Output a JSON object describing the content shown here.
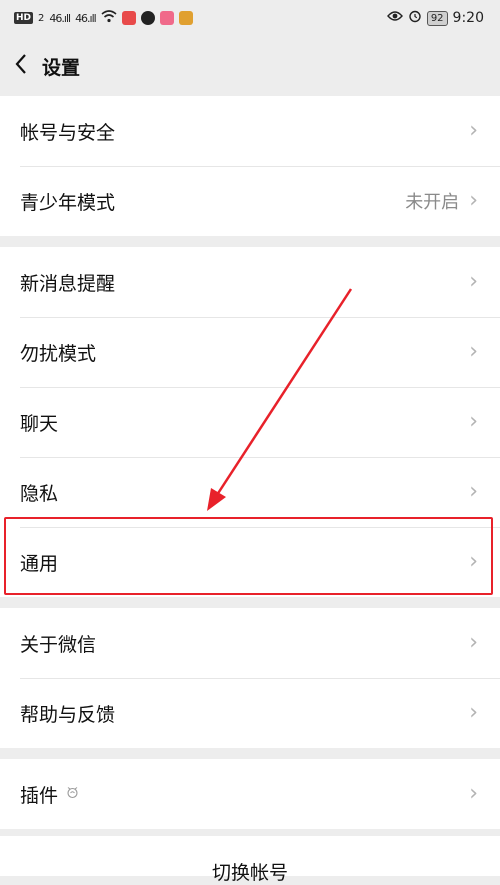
{
  "status_bar": {
    "hd": "HD",
    "hd_sub": "2",
    "signal1": "46.ıll",
    "signal2": "46.ıll",
    "battery": "92",
    "time": "9:20",
    "icons": [
      "wifi-icon",
      "app-icon",
      "wechat-icon",
      "app-icon",
      "app-icon",
      "eye-icon",
      "alarm-icon"
    ]
  },
  "header": {
    "back_icon": "chevron-left-icon",
    "title": "设置"
  },
  "groups": [
    {
      "items": [
        {
          "label": "帐号与安全",
          "value": ""
        },
        {
          "label": "青少年模式",
          "value": "未开启"
        }
      ]
    },
    {
      "items": [
        {
          "label": "新消息提醒"
        },
        {
          "label": "勿扰模式"
        },
        {
          "label": "聊天"
        },
        {
          "label": "隐私"
        },
        {
          "label": "通用"
        }
      ]
    },
    {
      "items": [
        {
          "label": "关于微信"
        },
        {
          "label": "帮助与反馈"
        }
      ]
    },
    {
      "items": [
        {
          "label": "插件"
        }
      ]
    }
  ],
  "bottom": {
    "switch_account": "切换帐号"
  },
  "colors": {
    "annotation_red": "#e8212a",
    "background": "#ededed"
  }
}
